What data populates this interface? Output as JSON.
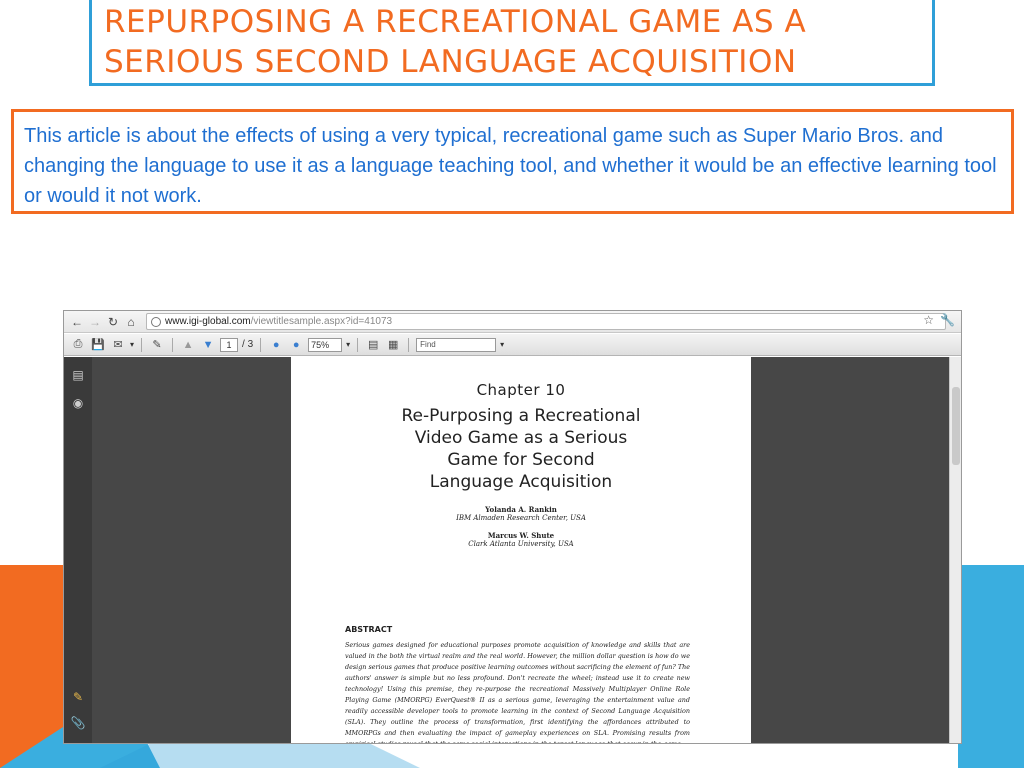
{
  "title": "REPURPOSING A RECREATIONAL GAME AS A SERIOUS SECOND LANGUAGE ACQUISITION",
  "summary": "This article is about the effects of using a very typical, recreational game such as Super Mario Bros. and changing the language to use it as a language teaching tool, and whether it would be an effective learning tool or would it not work.",
  "browser": {
    "url_host": "www.igi-global.com",
    "url_path": "/viewtitlesample.aspx?id=41073",
    "toolbar": {
      "page_current": "1",
      "page_total": "/ 3",
      "zoom": "75%",
      "find_placeholder": "Find"
    }
  },
  "pdf": {
    "chapter": "Chapter 10",
    "book_title": [
      "Re-Purposing a Recreational",
      "Video Game as a Serious",
      "Game for Second",
      "Language Acquisition"
    ],
    "authors": [
      {
        "name": "Yolanda A. Rankin",
        "affiliation": "IBM Almaden Research Center, USA"
      },
      {
        "name": "Marcus W. Shute",
        "affiliation": "Clark Atlanta University, USA"
      }
    ],
    "abstract_heading": "ABSTRACT",
    "abstract_text": "Serious games designed for educational purposes promote acquisition of knowledge and skills that are valued in the both the virtual realm and the real world. However, the million dollar question is how do we design serious games that produce positive learning outcomes without sacrificing the element of fun? The authors' answer is simple but no less profound. Don't recreate the wheel; instead use it to create new technology! Using this premise, they re-purpose the recreational Massively Multiplayer Online Role Playing Game (MMORPG) EverQuest® II as a serious game, leveraging the entertainment value and readily accessible developer tools to promote learning in the context of Second Language Acquisition (SLA). They outline the process of transformation, first identifying the affordances attributed to MMORPGs and then evaluating the impact of gameplay experiences on SLA. Promising results from empirical studies reveal that the same social interactions in the target language that occur in the game"
  },
  "colors": {
    "title": "#f26b21",
    "title_border": "#2f9fd8",
    "summary_text": "#1f6fd1",
    "summary_border": "#f26b21",
    "band_orange": "#f26b21",
    "band_blue": "#3aaedf"
  }
}
